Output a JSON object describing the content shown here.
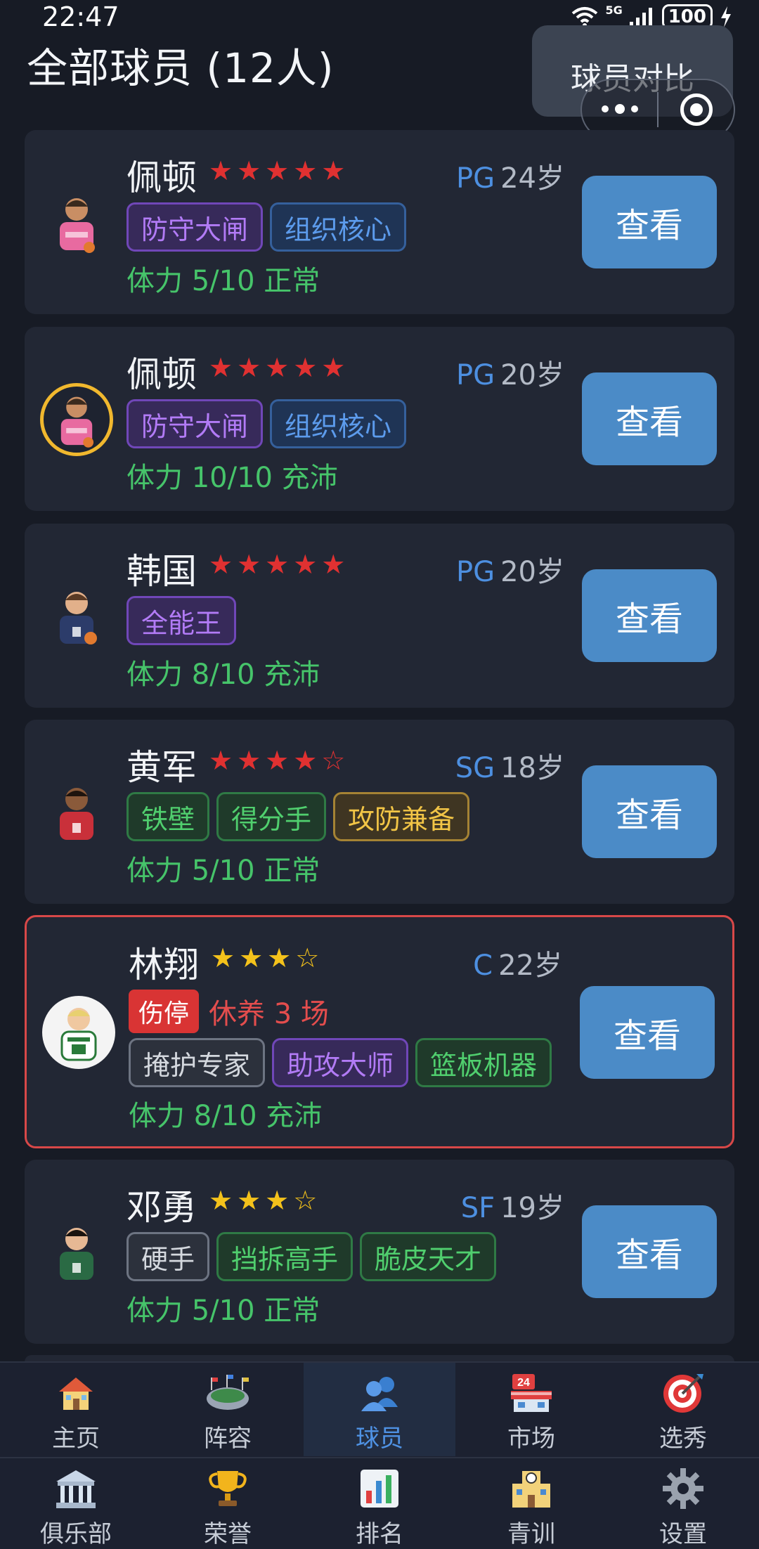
{
  "status_bar": {
    "time": "22:47",
    "network": "5G",
    "battery": "100"
  },
  "header": {
    "title": "全部球员 (12人)",
    "compare_label": "球员对比"
  },
  "players": [
    {
      "name": "佩顿",
      "stars": "★★★★★",
      "position": "PG",
      "age": "24岁",
      "tags": [
        "防守大闸",
        "组织核心"
      ],
      "stamina": "体力 5/10 正常",
      "button": "查看"
    },
    {
      "name": "佩顿",
      "stars": "★★★★★",
      "position": "PG",
      "age": "20岁",
      "tags": [
        "防守大闸",
        "组织核心"
      ],
      "stamina": "体力 10/10 充沛",
      "button": "查看"
    },
    {
      "name": "韩国",
      "stars": "★★★★★",
      "position": "PG",
      "age": "20岁",
      "tags": [
        "全能王"
      ],
      "stamina": "体力 8/10 充沛",
      "button": "查看"
    },
    {
      "name": "黄军",
      "stars_on": "★★★★",
      "stars_off": "☆",
      "position": "SG",
      "age": "18岁",
      "tags": [
        "铁壁",
        "得分手",
        "攻防兼备"
      ],
      "stamina": "体力 5/10 正常",
      "button": "查看"
    },
    {
      "name": "林翔",
      "stars_on": "★★★",
      "stars_off": "☆",
      "position": "C",
      "age": "22岁",
      "injury_badge": "伤停",
      "injury_text": "休养 3 场",
      "tags": [
        "掩护专家",
        "助攻大师",
        "篮板机器"
      ],
      "stamina": "体力 8/10 充沛",
      "button": "查看"
    },
    {
      "name": "邓勇",
      "stars_on": "★★★",
      "stars_off": "☆",
      "position": "SF",
      "age": "19岁",
      "tags": [
        "硬手",
        "挡拆高手",
        "脆皮天才"
      ],
      "stamina": "体力 5/10 正常",
      "button": "查看"
    }
  ],
  "nav": {
    "row1": [
      "主页",
      "阵容",
      "球员",
      "市场",
      "选秀"
    ],
    "row2": [
      "俱乐部",
      "荣誉",
      "排名",
      "青训",
      "设置"
    ],
    "active": "球员"
  },
  "colors": {
    "accent": "#4b8bc7",
    "star_red": "#e03131",
    "star_gold": "#f4c21b",
    "stamina_green": "#46c46a",
    "injury_red": "#d93434"
  },
  "icons": [
    "house-icon",
    "stadium-icon",
    "players-icon",
    "calendar-market-icon",
    "target-icon",
    "bank-icon",
    "trophy-icon",
    "bar-chart-icon",
    "school-icon",
    "gear-icon"
  ]
}
